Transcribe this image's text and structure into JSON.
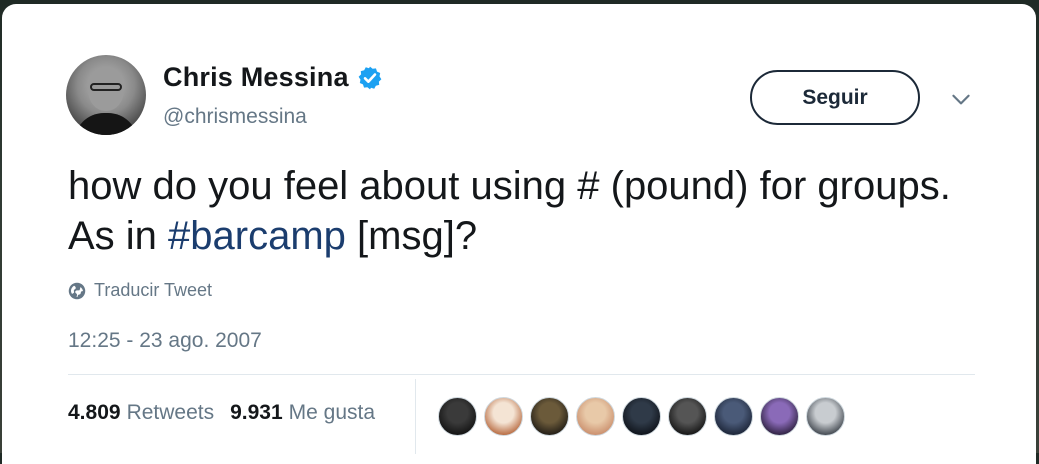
{
  "user": {
    "name": "Chris Messina",
    "handle": "@chrismessina",
    "verified": true
  },
  "follow_label": "Seguir",
  "tweet": {
    "text_before": "how do you feel about using # (pound) for groups. As in ",
    "hashtag": "#barcamp",
    "text_after": " [msg]?"
  },
  "translate_label": "Traducir Tweet",
  "timestamp": "12:25 - 23 ago. 2007",
  "stats": {
    "retweets_count": "4.809",
    "retweets_label": "Retweets",
    "likes_count": "9.931",
    "likes_label": "Me gusta"
  },
  "likers": [
    {
      "color_a": "#3a3a3a",
      "color_b": "#111111"
    },
    {
      "color_a": "#f4e4d4",
      "color_b": "#b5653a"
    },
    {
      "color_a": "#6b5a3a",
      "color_b": "#1e1a14"
    },
    {
      "color_a": "#e8c9a8",
      "color_b": "#c98c6a"
    },
    {
      "color_a": "#2f3a48",
      "color_b": "#0d1118"
    },
    {
      "color_a": "#555555",
      "color_b": "#121212"
    },
    {
      "color_a": "#4a5a78",
      "color_b": "#1a2234"
    },
    {
      "color_a": "#8a6ab8",
      "color_b": "#2a1e3a"
    },
    {
      "color_a": "#c8ccd0",
      "color_b": "#3a4048"
    }
  ],
  "colors": {
    "verified_badge": "#1da1f2",
    "hashtag": "#1b3d6e",
    "secondary_text": "#657786"
  }
}
